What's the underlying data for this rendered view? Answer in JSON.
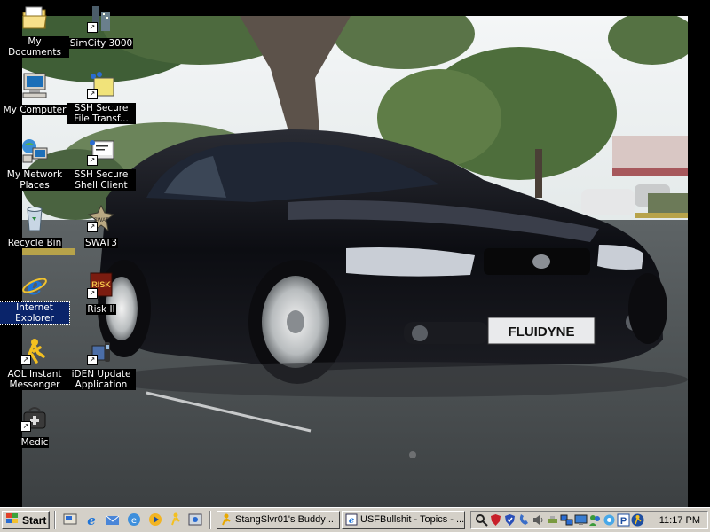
{
  "desktop": {
    "icons": [
      {
        "label": "My Documents",
        "icon": "folder-icon"
      },
      {
        "label": "SimCity 3000",
        "icon": "simcity-icon"
      },
      {
        "label": "My Computer",
        "icon": "computer-icon"
      },
      {
        "label": "SSH Secure File Transf...",
        "icon": "ssh-file-transfer-icon"
      },
      {
        "label": "My Network Places",
        "icon": "network-icon"
      },
      {
        "label": "SSH Secure Shell Client",
        "icon": "ssh-client-icon"
      },
      {
        "label": "Recycle Bin",
        "icon": "recycle-bin-icon"
      },
      {
        "label": "SWAT3",
        "icon": "swat3-icon"
      },
      {
        "label": "Internet Explorer",
        "icon": "internet-explorer-icon"
      },
      {
        "label": "Risk II",
        "icon": "risk-icon"
      },
      {
        "label": "AOL Instant Messenger",
        "icon": "aim-icon"
      },
      {
        "label": "iDEN Update Application",
        "icon": "iden-icon"
      },
      {
        "label": "Medic",
        "icon": "medic-icon"
      }
    ],
    "wallpaper": {
      "description_visible_text": "FLUIDYNE"
    }
  },
  "taskbar": {
    "start_label": "Start",
    "tasks": [
      {
        "label": "StangSlvr01's Buddy ..."
      },
      {
        "label": "USFBullshit - Topics - ..."
      }
    ],
    "clock": "11:17 PM"
  },
  "colors": {
    "taskbar": "#d4d0c8",
    "selection": "#0a246a"
  }
}
